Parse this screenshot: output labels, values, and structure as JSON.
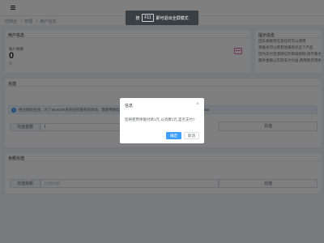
{
  "breadcrumb": [
    "控制台",
    "管理",
    "用户信息"
  ],
  "fullscreen_hint": {
    "key": "F11",
    "text": "即可退出全屏模式"
  },
  "user_info": {
    "title": "用户信息",
    "balance_label": "账户余额",
    "balance_value": "0",
    "balance_unit": "元"
  },
  "tips": {
    "title": "提示信息",
    "lines": [
      "团队规模受信息任何可以调用",
      "余额也可以用其他来购买这个产品",
      "因为支付宝或微信的审核限制,请不要大于",
      "最终金额以实际支付为准,费用和可用余额是分开计费的"
    ]
  },
  "recharge": {
    "title": "充值",
    "notice": "经过授权生效，为了MuXIDR系统任何服务的体验，需使用微信扫码支付，或者其他方式，请联系客服QQ：974907355",
    "amount_label": "充值金额",
    "amount_value": "1",
    "button_label": "充值"
  },
  "balance_query": {
    "title": "余额充值",
    "label": "充值余额",
    "placeholder": "充值余额",
    "button_label": "充值"
  },
  "dialog": {
    "title": "信息",
    "close_icon": "close-icon",
    "message": "您将使用余额付款1元,以消费1元,是否支付?",
    "confirm_label": "确定",
    "cancel_label": "取消"
  },
  "colors": {
    "primary": "#409eff",
    "overlay": "rgba(0,0,0,0.5)",
    "wallet": "#e06aa8"
  }
}
